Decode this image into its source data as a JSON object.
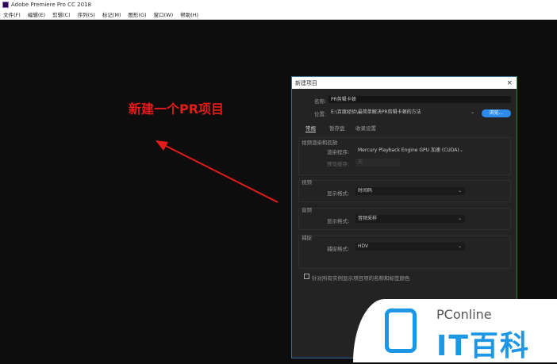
{
  "app": {
    "title": "Adobe Premiere Pro CC 2018"
  },
  "menu": [
    "文件(F)",
    "编辑(E)",
    "剪辑(C)",
    "序列(S)",
    "标记(M)",
    "图形(G)",
    "窗口(W)",
    "帮助(H)"
  ],
  "annotation": "新建一个PR项目",
  "dialog": {
    "title": "新建项目",
    "close": "×",
    "name_label": "名称:",
    "name_value": "PR剪辑卡顿",
    "location_label": "位置:",
    "location_value": "E:\\百度经验\\最简单解决PR剪辑卡顿的方法",
    "browse": "浏览...",
    "tabs": [
      "常规",
      "暂存盘",
      "收录设置"
    ],
    "render_group": "视频渲染和回放",
    "renderer_label": "渲染程序:",
    "renderer_value": "Mercury Playback Engine GPU 加速 (CUDA)",
    "preview_cache_label": "预览缓存:",
    "preview_cache_value": "无",
    "video_group": "视频",
    "video_display_label": "显示格式:",
    "video_display_value": "时间码",
    "audio_group": "音频",
    "audio_display_label": "显示格式:",
    "audio_display_value": "音频采样",
    "capture_group": "捕捉",
    "capture_format_label": "捕捉格式:",
    "capture_format_value": "HDV",
    "checkbox_label": "针对所有实例显示项目项的名称和标签颜色"
  },
  "watermark": {
    "brand": "PConline",
    "name": "IT百科"
  }
}
